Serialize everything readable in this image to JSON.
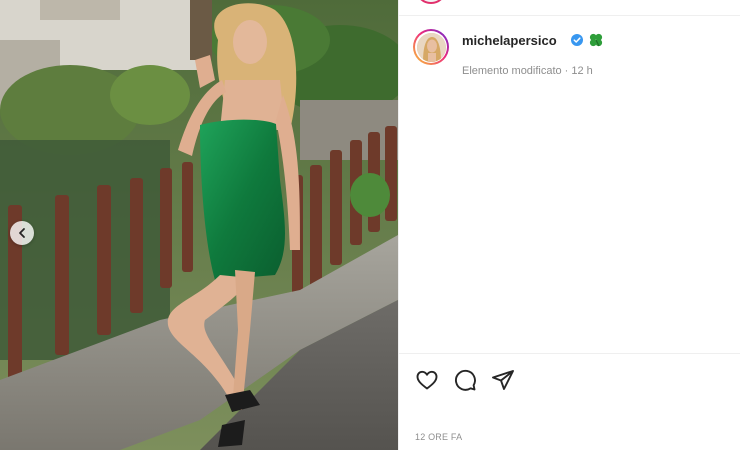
{
  "post": {
    "username": "michelapersico",
    "edited_label": "Elemento modificato",
    "separator": "·",
    "relative_time": "12 h",
    "timestamp": "12 ORE FA"
  },
  "icons": {
    "verified": "verified-badge-icon",
    "clover": "four-leaf-clover-emoji",
    "carousel_prev": "chevron-left-icon",
    "like": "heart-icon",
    "comment": "speech-bubble-icon",
    "share": "paper-plane-icon"
  },
  "colors": {
    "verified_blue": "#3897f0",
    "clover_green": "#2e9e3a",
    "meta_gray": "#8e8e8e",
    "text_dark": "#262626"
  }
}
